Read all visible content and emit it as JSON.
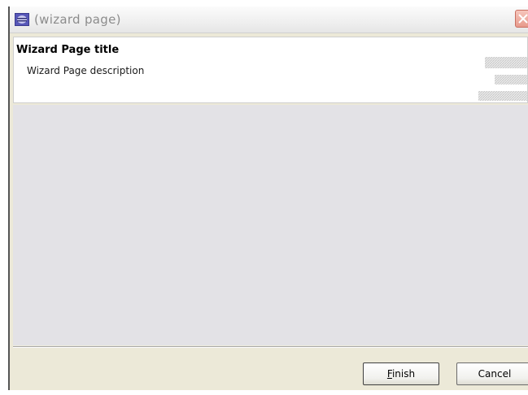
{
  "window": {
    "title": "(wizard page)",
    "app_icon": "eclipse-app-icon",
    "close_icon": "close-x-icon"
  },
  "header": {
    "page_title": "Wizard Page title",
    "page_description": "Wizard Page description",
    "banner_image": "wizard-banner-image"
  },
  "buttons": {
    "finish": {
      "mnemonic": "F",
      "rest": "inish"
    },
    "cancel_label": "Cancel"
  },
  "colors": {
    "content_background": "#e3e2e6",
    "dialog_background": "#ece9d8",
    "close_button": "#e79a8c"
  }
}
